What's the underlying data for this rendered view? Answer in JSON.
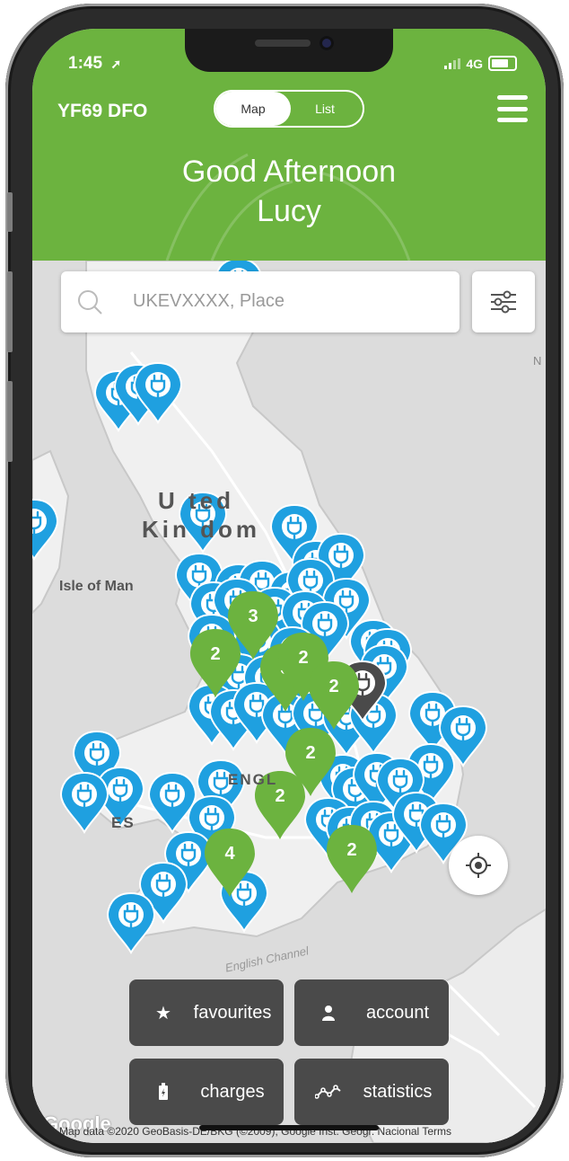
{
  "status_bar": {
    "time": "1:45",
    "network": "4G"
  },
  "header": {
    "plate": "YF69 DFO",
    "toggle": {
      "selected": "Map",
      "other": "List"
    },
    "greeting_line1": "Good Afternoon",
    "greeting_line2": "Lucy"
  },
  "search": {
    "placeholder": "UKEVXXXX, Place"
  },
  "map_labels": {
    "country_top": "U  ted",
    "country_bottom": "Kin  dom",
    "isle_of_man": "Isle of Man",
    "england": "ENGL",
    "wales": "ES",
    "english_channel": "English Channel",
    "edge_label": "N"
  },
  "buttons": {
    "favourites": "favourites",
    "account": "account",
    "charges": "charges",
    "statistics": "statistics"
  },
  "attribution": "Map data ©2020 GeoBasis-DE/BKG (©2009), Google Inst. Geogr. Nacional     Terms",
  "google_logo": "Google",
  "colors": {
    "brand_green": "#6cb33f",
    "pin_blue": "#1fa0e0",
    "cluster_green": "#6cb33f",
    "button_dark": "#4a4a4a"
  },
  "pins": {
    "blue_count_visible": 60,
    "clusters": [
      "3",
      "2",
      "3",
      "2",
      "2",
      "2",
      "2",
      "4",
      "2"
    ]
  }
}
